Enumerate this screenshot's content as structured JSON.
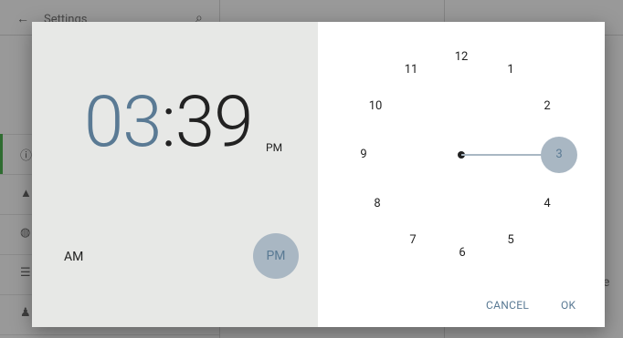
{
  "background": {
    "title": "Settings"
  },
  "time_picker": {
    "hour": "03",
    "separator": ":",
    "minute": "39",
    "period_small": "PM",
    "am_label": "AM",
    "pm_label": "PM",
    "clock_numbers": {
      "n12": "12",
      "n1": "1",
      "n2": "2",
      "n3": "3",
      "n4": "4",
      "n5": "5",
      "n6": "6",
      "n7": "7",
      "n8": "8",
      "n9": "9",
      "n10": "10",
      "n11": "11"
    },
    "cancel_label": "CANCEL",
    "ok_label": "OK"
  },
  "colors": {
    "accent": "#5a7a94",
    "selector": "#a9b7c3",
    "left_pane": "#e7e8e6"
  }
}
